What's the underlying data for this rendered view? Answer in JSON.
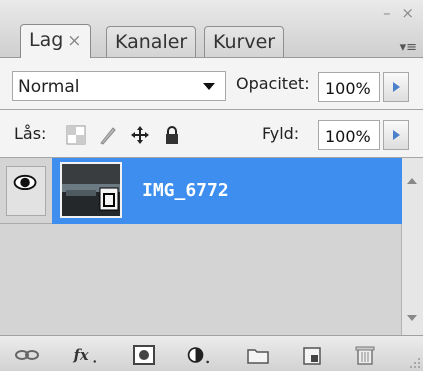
{
  "window": {
    "controls": "– ×"
  },
  "tabs": [
    {
      "label": "Lag",
      "close": "×",
      "active": true
    },
    {
      "label": "Kanaler",
      "active": false
    },
    {
      "label": "Kurver",
      "active": false
    }
  ],
  "panel_menu": "▾≡",
  "blend": {
    "value": "Normal"
  },
  "opacity": {
    "label": "Opacitet:",
    "value": "100%"
  },
  "lock": {
    "label": "Lås:"
  },
  "fill": {
    "label": "Fyld:",
    "value": "100%"
  },
  "layers": [
    {
      "name": "IMG_6772",
      "visible": true,
      "selected": true
    }
  ],
  "colors": {
    "selection": "#3d8eef",
    "accent_arrow": "#4a7fc9"
  },
  "icons": {
    "link": "link-icon",
    "fx": "fx",
    "mask": "mask-icon",
    "adjust": "adjustment-icon",
    "folder": "folder-icon",
    "new_layer": "new-layer-icon",
    "trash": "trash-icon"
  }
}
